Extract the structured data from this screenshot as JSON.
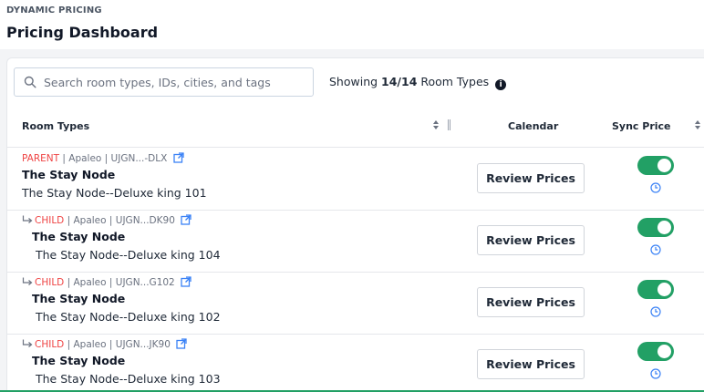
{
  "header": {
    "eyebrow": "DYNAMIC PRICING",
    "title": "Pricing Dashboard"
  },
  "search": {
    "placeholder": "Search room types, IDs, cities, and tags",
    "value": ""
  },
  "summary": {
    "prefix": "Showing ",
    "count": "14/14",
    "suffix": " Room Types"
  },
  "table": {
    "columns": {
      "room_types": "Room Types",
      "calendar": "Calendar",
      "sync_price": "Sync Price"
    },
    "rows": [
      {
        "tag": "PARENT",
        "meta": " | Apaleo | UJGN...-DLX",
        "name": "The Stay Node",
        "description": "The Stay Node--Deluxe king 101",
        "action": "Review Prices",
        "sync_on": true
      },
      {
        "tag": "CHILD",
        "meta": " | Apaleo | UJGN...DK90",
        "name": "The Stay Node",
        "description": "The Stay Node--Deluxe king 104",
        "action": "Review Prices",
        "sync_on": true
      },
      {
        "tag": "CHILD",
        "meta": " | Apaleo | UJGN...G102",
        "name": "The Stay Node",
        "description": "The Stay Node--Deluxe king 102",
        "action": "Review Prices",
        "sync_on": true
      },
      {
        "tag": "CHILD",
        "meta": " | Apaleo | UJGN...JK90",
        "name": "The Stay Node",
        "description": "The Stay Node--Deluxe king 103",
        "action": "Review Prices",
        "sync_on": true
      }
    ]
  },
  "colors": {
    "accent_green": "#22a065",
    "tag_red": "#ef4444",
    "link_blue": "#3b82f6"
  },
  "icons": {
    "search": "search-icon",
    "info": "info-icon",
    "sort": "sort-icon",
    "external_link": "external-link-icon",
    "child_arrow": "child-arrow-icon",
    "history": "clock-icon"
  }
}
